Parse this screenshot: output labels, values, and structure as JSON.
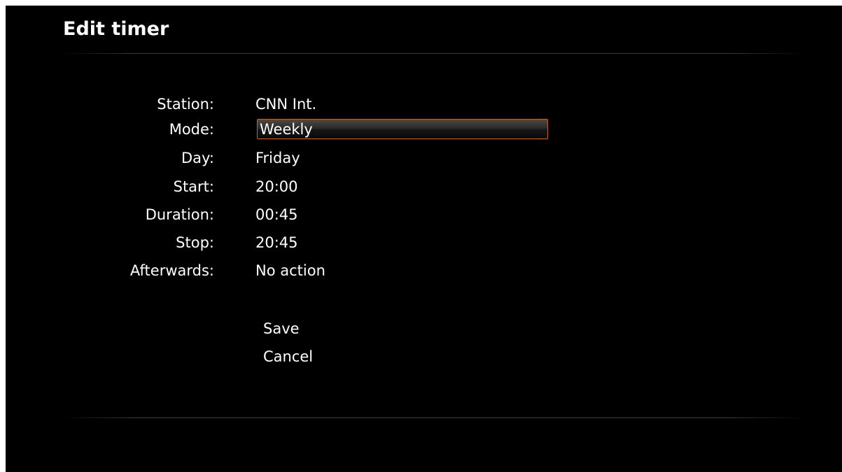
{
  "dialog": {
    "title": "Edit timer"
  },
  "fields": [
    {
      "label": "Station:",
      "value": "CNN Int."
    },
    {
      "label": "Mode:",
      "value": "Weekly"
    },
    {
      "label": "Day:",
      "value": "Friday"
    },
    {
      "label": "Start:",
      "value": "20:00"
    },
    {
      "label": "Duration:",
      "value": "00:45"
    },
    {
      "label": "Stop:",
      "value": "20:45"
    },
    {
      "label": "Afterwards:",
      "value": "No action"
    }
  ],
  "actions": {
    "save_label": "Save",
    "cancel_label": "Cancel"
  },
  "colors": {
    "background": "#000000",
    "text": "#ffffff",
    "focus_border": "#c8641a"
  }
}
